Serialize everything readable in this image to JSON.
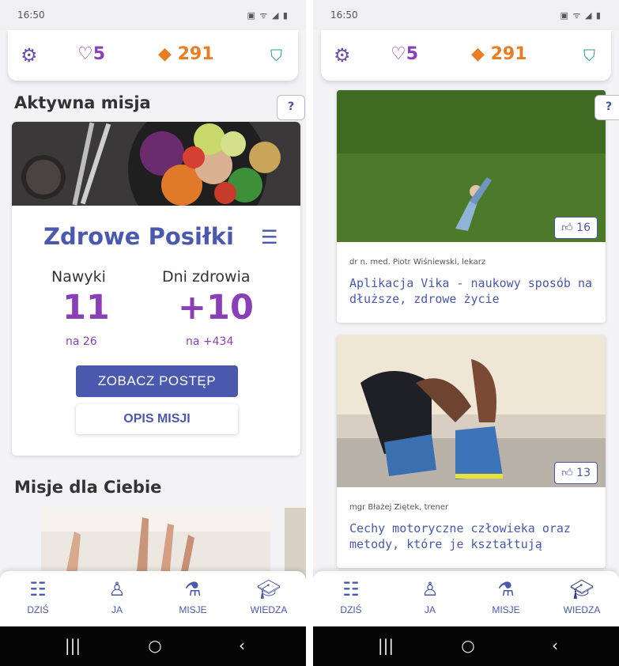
{
  "colors": {
    "accent": "#4a59ad",
    "purple": "#8b3fb6",
    "orange": "#e87d23",
    "teal": "#2e9b9b"
  },
  "status_bar": {
    "time": "16:50"
  },
  "top_bar": {
    "hearts": "5",
    "gems": "291"
  },
  "left_screen": {
    "active_mission_title": "Aktywna misja",
    "help_label": "?",
    "mission": {
      "name": "Zdrowe Posiłki",
      "stats": [
        {
          "label": "Nawyki",
          "value": "11",
          "sub": "na 26"
        },
        {
          "label": "Dni zdrowia",
          "value": "+10",
          "sub": "na +434"
        }
      ],
      "primary_button": "ZOBACZ POSTĘP",
      "secondary_button": "OPIS MISJI"
    },
    "missions_for_you_title": "Misje dla Ciebie"
  },
  "right_screen": {
    "help_label": "?",
    "articles": [
      {
        "likes": "16",
        "author": "dr n. med. Piotr Wiśniewski, lekarz",
        "title": "Aplikacja Vika - naukowy sposób na dłuższe, zdrowe życie"
      },
      {
        "likes": "13",
        "author": "mgr Błażej Ziętek, trener",
        "title": "Cechy motoryczne człowieka oraz metody, które je kształtują"
      }
    ]
  },
  "bottom_nav": {
    "items": [
      {
        "label": "DZIŚ",
        "icon": "list-icon"
      },
      {
        "label": "JA",
        "icon": "person-icon"
      },
      {
        "label": "MISJE",
        "icon": "flask-icon"
      },
      {
        "label": "WIEDZA",
        "icon": "graduation-cap-icon"
      }
    ]
  }
}
